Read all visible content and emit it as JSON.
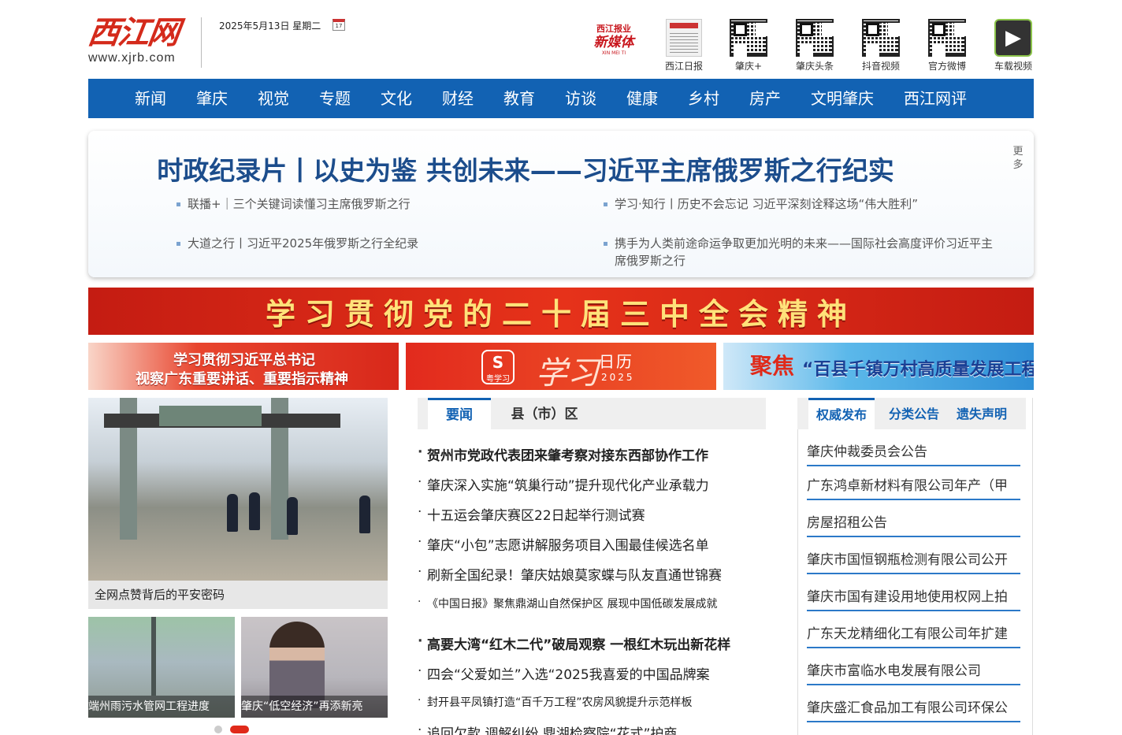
{
  "header": {
    "logo_text": "西江网",
    "logo_url": "www.xjrb.com",
    "date": "2025年5月13日 星期二",
    "calendar_day": "17",
    "xmt": {
      "top": "西江报业",
      "main": "新媒体",
      "sub": "XIN MEI TI"
    },
    "links": [
      {
        "label": "西江日报",
        "icon": "newspaper-icon"
      },
      {
        "label": "肇庆+",
        "icon": "qr-code-icon"
      },
      {
        "label": "肇庆头条",
        "icon": "qr-code-icon"
      },
      {
        "label": "抖音视频",
        "icon": "qr-code-icon"
      },
      {
        "label": "官方微博",
        "icon": "qr-code-icon"
      },
      {
        "label": "车载视频",
        "icon": "play-icon"
      }
    ]
  },
  "nav": [
    "新闻",
    "肇庆",
    "视觉",
    "专题",
    "文化",
    "财经",
    "教育",
    "访谈",
    "健康",
    "乡村",
    "房产",
    "文明肇庆",
    "西江网评"
  ],
  "headline": {
    "title": "时政纪录片丨以史为鉴 共创未来——习近平主席俄罗斯之行纪实",
    "more": "更多",
    "links": [
      "联播+｜三个关键词读懂习主席俄罗斯之行",
      "学习·知行丨历史不会忘记 习近平深刻诠释这场“伟大胜利”",
      "大道之行丨习近平2025年俄罗斯之行全纪录",
      "携手为人类前途命运争取更加光明的未来——国际社会高度评价习近平主席俄罗斯之行"
    ]
  },
  "banner": "学习贯彻党的二十届三中全会精神",
  "sub_banners": {
    "b1_line1": "学习贯彻习近平总书记",
    "b1_line2": "视察广东重要讲话、重要指示精神",
    "b2_app": "粤学习",
    "b2_big": "学习",
    "b2_rili": "日历",
    "b2_year": "2025",
    "b3_jj": "聚焦",
    "b3_slogan": "“百县千镇万村高质量发展工程”"
  },
  "photo": {
    "main_caption": "全网点赞背后的平安密码",
    "thumb1_caption": "端州雨污水管网工程进度",
    "thumb2_caption": "肇庆“低空经济”再添新亮"
  },
  "mid_tabs": [
    "要闻",
    "县（市）区"
  ],
  "news": [
    {
      "text": "贺州市党政代表团来肇考察对接东西部协作工作",
      "style": "bold"
    },
    {
      "text": "肇庆深入实施“筑巢行动”提升现代化产业承载力",
      "style": "reg"
    },
    {
      "text": "十五运会肇庆赛区22日起举行测试赛",
      "style": "reg"
    },
    {
      "text": "肇庆“小包”志愿讲解服务项目入围最佳候选名单",
      "style": "reg"
    },
    {
      "text": "刷新全国纪录！肇庆姑娘莫家蝶与队友直通世锦赛",
      "style": "reg"
    },
    {
      "text": "《中国日报》聚焦鼎湖山自然保护区 展现中国低碳发展成就",
      "style": "sm"
    },
    {
      "text": "高要大湾“红木二代”破局观察 一根红木玩出新花样",
      "style": "bold"
    },
    {
      "text": "四会“父爱如兰”入选“2025我喜爱的中国品牌案",
      "style": "reg"
    },
    {
      "text": "封开县平凤镇打造“百千万工程”农房风貌提升示范样板",
      "style": "sm"
    },
    {
      "text": "追回欠款 调解纠纷 鼎湖检察院“花式”护商",
      "style": "reg"
    }
  ],
  "right_tabs": [
    "权威发布",
    "分类公告",
    "遗失声明"
  ],
  "notices": [
    "肇庆仲裁委员会公告",
    "广东鸿卓新材料有限公司年产（甲",
    "房屋招租公告",
    "肇庆市国恒钢瓶检测有限公司公开",
    "肇庆市国有建设用地使用权网上拍",
    "广东天龙精细化工有限公司年扩建",
    "肇庆市富临水电发展有限公司",
    "肇庆盛汇食品加工有限公司环保公"
  ]
}
